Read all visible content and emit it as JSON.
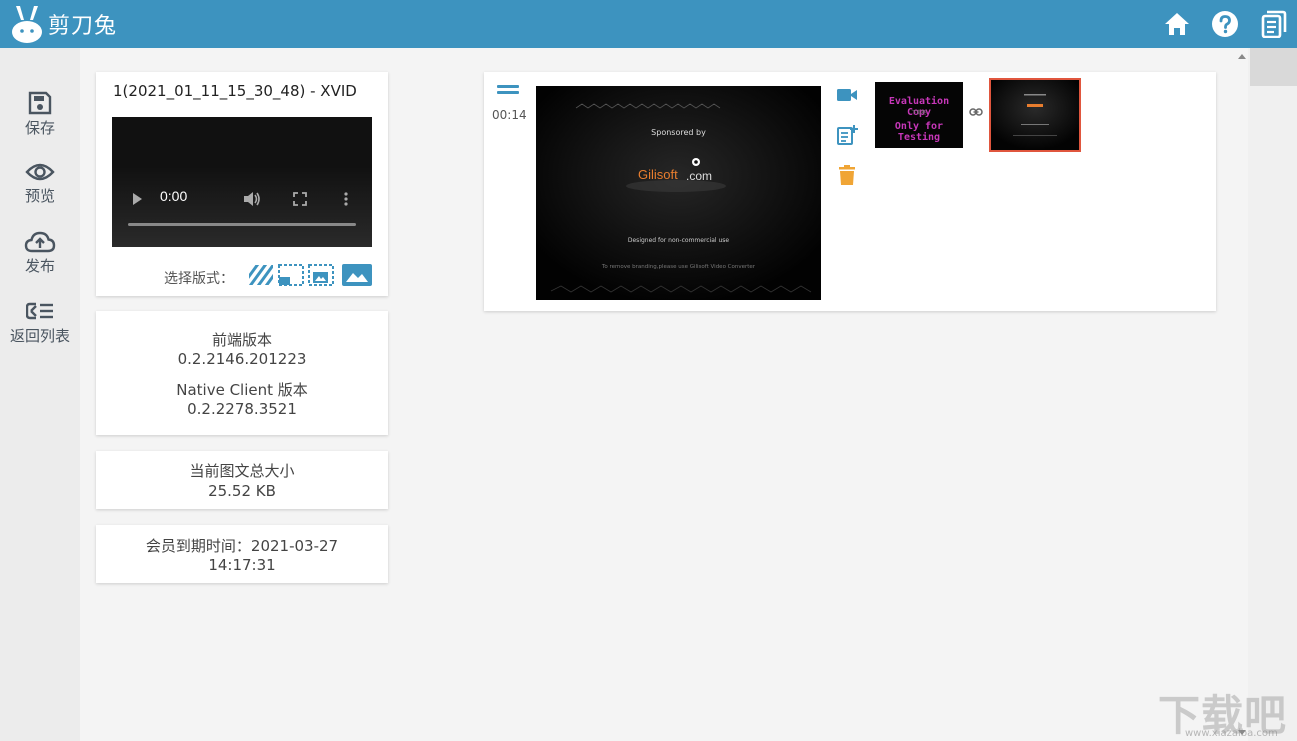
{
  "app": {
    "title": "剪刀兔",
    "accent_color": "#3d93bf",
    "header_icons": [
      "home-icon",
      "help-icon",
      "book-icon"
    ]
  },
  "sidebar": {
    "items": [
      {
        "label": "保存",
        "icon": "save-icon"
      },
      {
        "label": "预览",
        "icon": "eye-icon"
      },
      {
        "label": "发布",
        "icon": "cloud-upload-icon"
      },
      {
        "label": "返回列表",
        "icon": "back-list-icon"
      }
    ]
  },
  "video_card": {
    "title": "1(2021_01_11_15_30_48) - XVID",
    "player_time": "0:00",
    "layout_label": "选择版式：",
    "layout_options": [
      "stripes-layout-icon",
      "text-bottom-layout-icon",
      "image-box-layout-icon",
      "image-full-layout-icon"
    ]
  },
  "version_card": {
    "frontend_label": "前端版本",
    "frontend_version": "0.2.2146.201223",
    "native_label": "Native Client 版本",
    "native_version": "0.2.2278.3521"
  },
  "size_card": {
    "label": "当前图文总大小",
    "value": "25.52 KB"
  },
  "member_card": {
    "line1": "会员到期时间：2021-03-27",
    "line2": "14:17:31"
  },
  "clip": {
    "time": "00:14",
    "frame_sponsored": "Sponsored by",
    "frame_brand": "Gilisoft",
    "frame_brand_suffix": ".com",
    "frame_designed": "Designed for non-commercial use",
    "frame_remove": "To remove branding,please use Gilisoft Video Converter",
    "thumb_line1": "Evaluation Copy",
    "thumb_line2": "下载吧",
    "thumb_line3": "Only for Testing",
    "action_icons": [
      "video-camera-icon",
      "add-note-icon",
      "trash-icon"
    ]
  },
  "watermark": {
    "text": "下载吧",
    "url": "www.xiazaiba.com"
  }
}
